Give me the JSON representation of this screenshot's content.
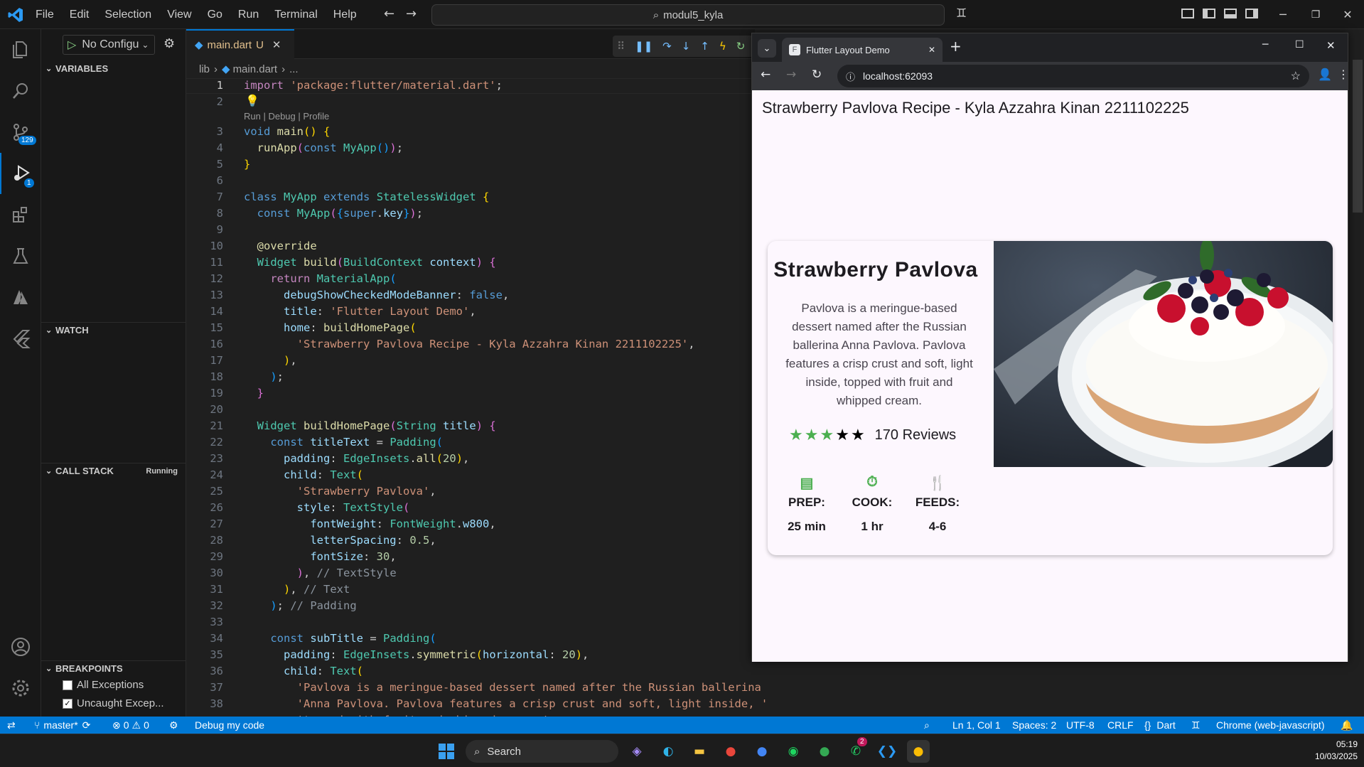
{
  "menu": [
    "File",
    "Edit",
    "Selection",
    "View",
    "Go",
    "Run",
    "Terminal",
    "Help"
  ],
  "search": "modul5_kyla",
  "activity": {
    "scm_badge": "129",
    "debug_badge": "1"
  },
  "debug_panel": {
    "config": "No Configu",
    "variables": "VARIABLES",
    "watch": "WATCH",
    "call_stack": "CALL STACK",
    "call_stack_status": "Running",
    "breakpoints": "BREAKPOINTS",
    "bp_all": "All Exceptions",
    "bp_uncaught": "Uncaught Excep..."
  },
  "editor": {
    "tab_label": "main.dart",
    "tab_status": "U",
    "breadcrumb_lib": "lib",
    "breadcrumb_file": "main.dart",
    "breadcrumb_more": "...",
    "codelens": "Run | Debug | Profile"
  },
  "lines": [
    "1",
    "2",
    "3",
    "4",
    "5",
    "6",
    "7",
    "8",
    "9",
    "10",
    "11",
    "12",
    "13",
    "14",
    "15",
    "16",
    "17",
    "18",
    "19",
    "20",
    "21",
    "22",
    "23",
    "24",
    "25",
    "26",
    "27",
    "28",
    "29",
    "30",
    "31",
    "32",
    "33",
    "34",
    "35",
    "36",
    "37",
    "38"
  ],
  "browser": {
    "tab_title": "Flutter Layout Demo",
    "url": "localhost:62093",
    "page_title": "Strawberry Pavlova Recipe - Kyla Azzahra Kinan 2211102225"
  },
  "recipe": {
    "title": "Strawberry Pavlova",
    "description": "Pavlova is a meringue-based dessert named after the Russian ballerina Anna Pavlova. Pavlova features a crisp crust and soft, light inside, topped with fruit and whipped cream.",
    "rating_stars": 3,
    "reviews": "170 Reviews",
    "prep_label": "PREP:",
    "prep_value": "25 min",
    "cook_label": "COOK:",
    "cook_value": "1 hr",
    "feeds_label": "FEEDS:",
    "feeds_value": "4-6"
  },
  "status": {
    "branch": "master*",
    "errors": "0",
    "warnings": "0",
    "debug": "Debug my code",
    "position": "Ln 1, Col 1",
    "spaces": "Spaces: 2",
    "encoding": "UTF-8",
    "eol": "CRLF",
    "language": "Dart",
    "device": "Chrome (web-javascript)"
  },
  "taskbar": {
    "search": "Search",
    "time": "05:19",
    "date": "10/03/2025",
    "whatsapp_badge": "2"
  }
}
